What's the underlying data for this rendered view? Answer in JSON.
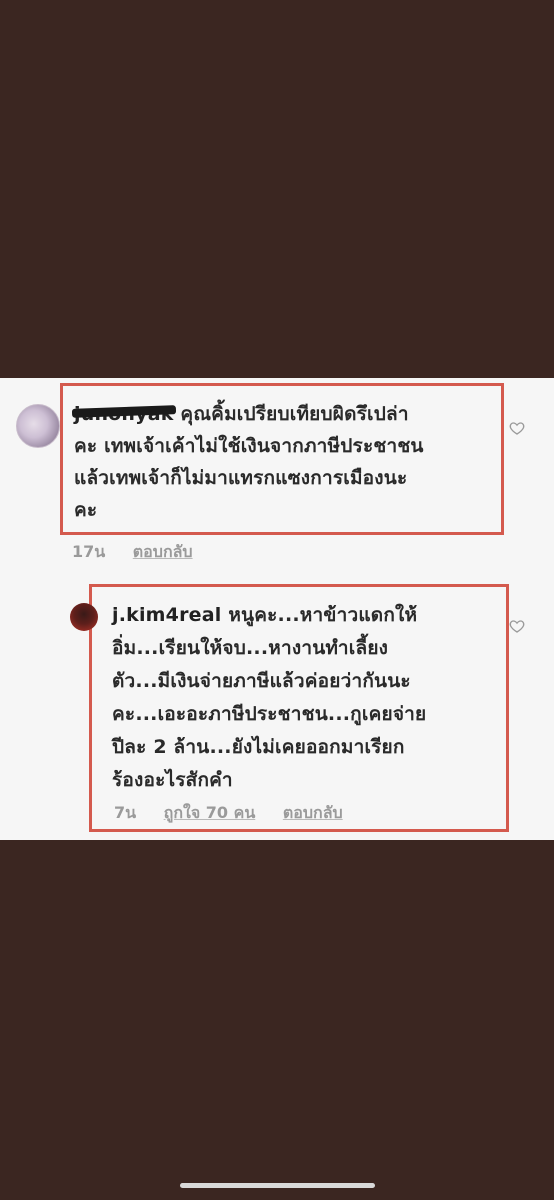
{
  "comments": [
    {
      "username": "junonyak",
      "text_lines": [
        "คุณคิ้มเปรียบเทียบผิดรึเปล่า",
        "คะ เทพเจ้าเค้าไม่ใช้เงินจากภาษีประชาชน",
        "แล้วเทพเจ้าก็ไม่มาแทรกแซงการเมืองนะ",
        "คะ"
      ],
      "time": "17น",
      "reply_label": "ตอบกลับ",
      "heart_icon": "heart-outline-icon"
    },
    {
      "username": "j.kim4real",
      "text_lines": [
        "หนูคะ...หาข้าวแดกให้",
        "อิ่ม...เรียนให้จบ...หางานทำเลี้ยง",
        "ตัว...มีเงินจ่ายภาษีแล้วค่อยว่ากันนะ",
        "คะ...เอะอะภาษีประชาชน...กูเคยจ่าย",
        "ปีละ 2 ล้าน...ยังไม่เคยออกมาเรียก",
        "ร้องอะไรสักคำ"
      ],
      "time": "7น",
      "likes_label": "ถูกใจ 70 คน",
      "reply_label": "ตอบกลับ",
      "heart_icon": "heart-outline-icon"
    }
  ],
  "colors": {
    "background": "#3b2621",
    "panel": "#f6f6f6",
    "highlight_border": "#d45a4e"
  }
}
